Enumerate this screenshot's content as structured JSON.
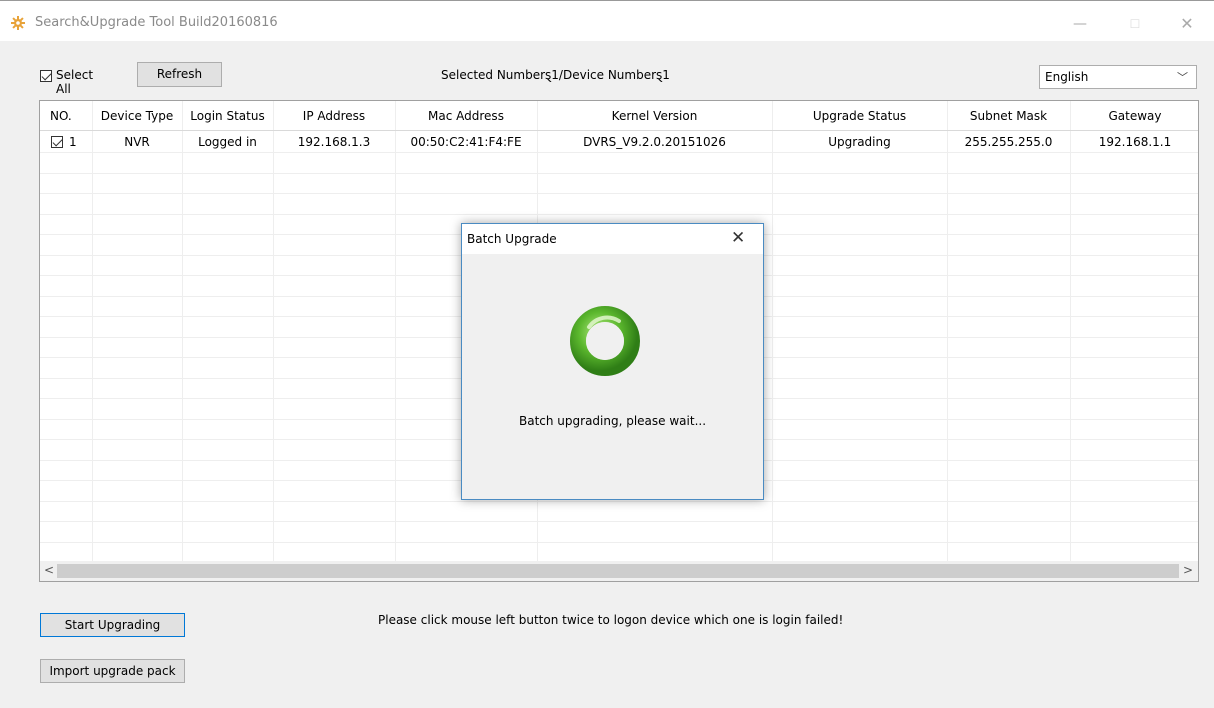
{
  "window": {
    "title": "Search&Upgrade Tool Build20160816",
    "minimize_glyph": "—",
    "maximize_glyph": "☐",
    "close_glyph": "✕"
  },
  "toolbar": {
    "select_all_label": "Select All",
    "select_all_checked": true,
    "refresh_label": "Refresh",
    "selected_count_text": "Selected Numberȿ1/Device Numberȿ1",
    "language_value": "English",
    "language_chevron": "﹀"
  },
  "table": {
    "headers": [
      "NO.",
      "Device Type",
      "Login Status",
      "IP Address",
      "Mac Address",
      "Kernel Version",
      "Upgrade Status",
      "Subnet Mask",
      "Gateway"
    ],
    "rows": [
      {
        "checked": true,
        "no": "1",
        "device_type": "NVR",
        "login_status": "Logged in",
        "ip": "192.168.1.3",
        "mac": "00:50:C2:41:F4:FE",
        "kernel": "DVRS_V9.2.0.20151026",
        "upgrade_status": "Upgrading",
        "subnet": "255.255.255.0",
        "gateway": "192.168.1.1"
      }
    ],
    "scroll_left": "<",
    "scroll_right": ">"
  },
  "footer": {
    "start_upgrade_label": "Start Upgrading",
    "import_pack_label": "Import upgrade pack",
    "hint": "Please click mouse left button twice to logon device which one is login failed!"
  },
  "dialog": {
    "title": "Batch Upgrade",
    "close_glyph": "✕",
    "message": "Batch upgrading, please wait..."
  },
  "colors": {
    "spinner_green": "#5cb82e",
    "accent_blue": "#0078d7"
  }
}
